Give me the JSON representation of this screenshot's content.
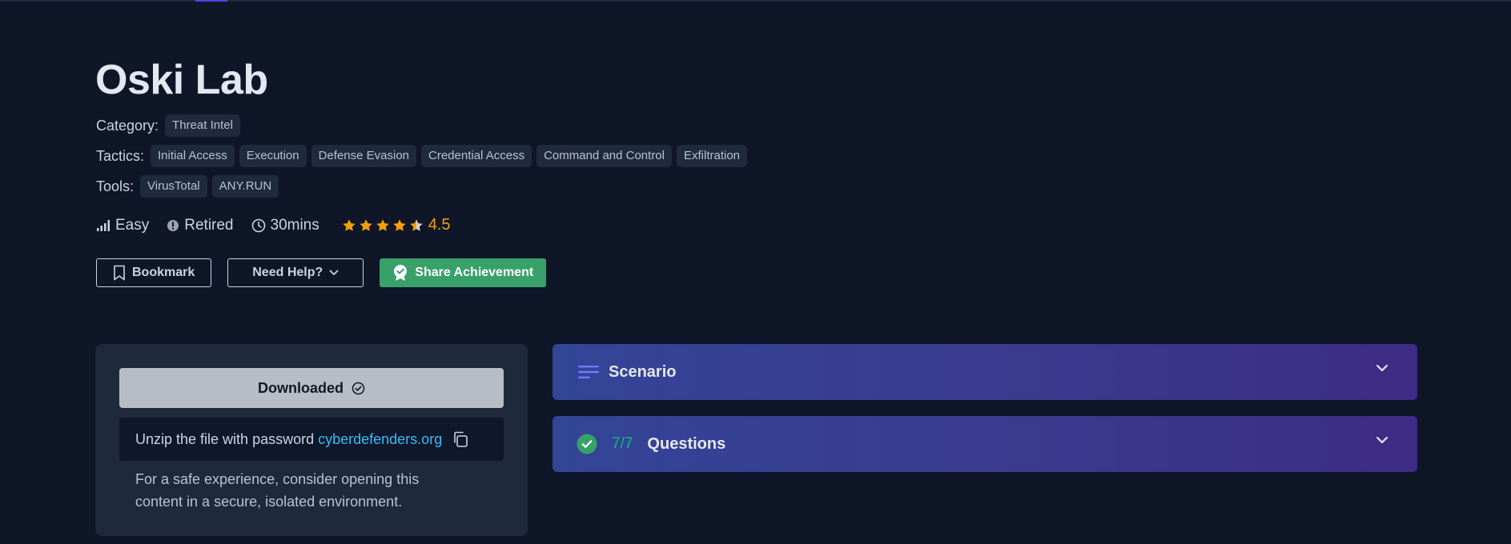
{
  "page": {
    "title": "Oski Lab",
    "category_label": "Category:",
    "category": "Threat Intel",
    "tactics_label": "Tactics:",
    "tactics": [
      "Initial Access",
      "Execution",
      "Defense Evasion",
      "Credential Access",
      "Command and Control",
      "Exfiltration"
    ],
    "tools_label": "Tools:",
    "tools": [
      "VirusTotal",
      "ANY.RUN"
    ]
  },
  "stats": {
    "difficulty": "Easy",
    "status": "Retired",
    "duration": "30mins",
    "rating": "4.5",
    "rating_value": 4.5,
    "rating_max": 5
  },
  "buttons": {
    "bookmark": "Bookmark",
    "need_help": "Need Help?",
    "share": "Share Achievement"
  },
  "download": {
    "label": "Downloaded",
    "password_text": "Unzip the file with password",
    "password": "cyberdefenders.org",
    "note": "For a safe experience, consider opening this content in a secure, isolated environment."
  },
  "sections": {
    "scenario": "Scenario",
    "questions": "Questions",
    "questions_progress": "7/7"
  },
  "colors": {
    "background": "#0e1628",
    "card": "#1e293b",
    "accent_green": "#38a169",
    "link": "#38bdf8",
    "star": "#f59e0b",
    "progress": "#10b981"
  },
  "icons": [
    "difficulty-bars-icon",
    "info-circle-icon",
    "clock-icon",
    "star-icon",
    "bookmark-icon",
    "chevron-down-icon",
    "award-icon",
    "check-circle-icon",
    "copy-icon",
    "lines-icon",
    "check-badge-icon"
  ]
}
